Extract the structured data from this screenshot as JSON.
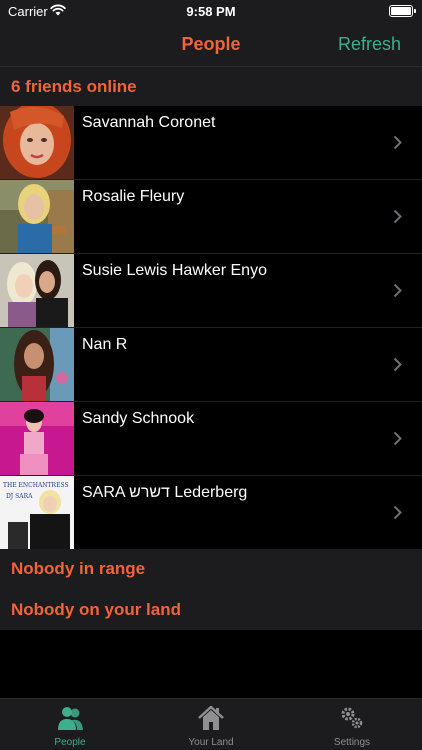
{
  "status_bar": {
    "carrier": "Carrier",
    "time": "9:58 PM"
  },
  "nav": {
    "title": "People",
    "refresh_label": "Refresh"
  },
  "sections": {
    "online": "6 friends online",
    "in_range": "Nobody in range",
    "on_land": "Nobody on your land"
  },
  "friends": [
    {
      "name": "Savannah Coronet"
    },
    {
      "name": "Rosalie Fleury"
    },
    {
      "name": "Susie Lewis Hawker Enyo"
    },
    {
      "name": "Nan R"
    },
    {
      "name": "Sandy Schnook"
    },
    {
      "name": "SARA דשרש Lederberg"
    }
  ],
  "avatar_overlay": {
    "banner_text": "THE ENCHANTRESS",
    "sub_text": "DJ SARA"
  },
  "tabs": [
    {
      "label": "People",
      "icon": "people-icon",
      "active": true
    },
    {
      "label": "Your Land",
      "icon": "house-icon",
      "active": false
    },
    {
      "label": "Settings",
      "icon": "gears-icon",
      "active": false
    }
  ],
  "colors": {
    "accent_orange": "#f0643c",
    "accent_green": "#3fae8c",
    "bar_background": "#1c1c1e",
    "inactive_tab": "#8e8e93"
  }
}
